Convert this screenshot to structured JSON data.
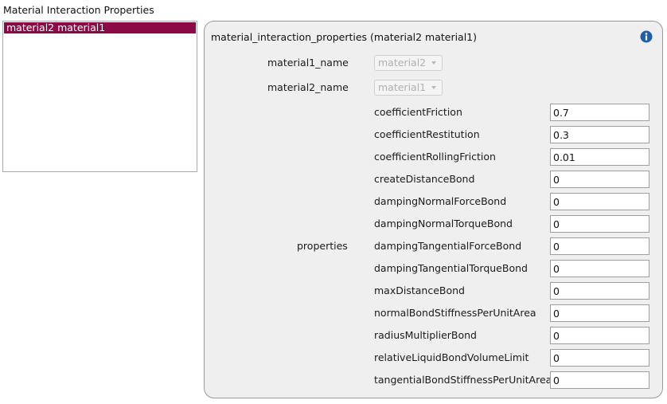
{
  "section_title": "Material Interaction Properties",
  "list": {
    "items": [
      {
        "label": "material2 material1",
        "selected": true
      }
    ]
  },
  "group": {
    "title": "material_interaction_properties (material2 material1)",
    "info_icon": "info-icon",
    "material1_name": {
      "label": "material1_name",
      "value": "material2"
    },
    "material2_name": {
      "label": "material2_name",
      "value": "material1"
    },
    "properties_label": "properties",
    "properties": [
      {
        "name": "coefficientFriction",
        "value": "0.7"
      },
      {
        "name": "coefficientRestitution",
        "value": "0.3"
      },
      {
        "name": "coefficientRollingFriction",
        "value": "0.01"
      },
      {
        "name": "createDistanceBond",
        "value": "0"
      },
      {
        "name": "dampingNormalForceBond",
        "value": "0"
      },
      {
        "name": "dampingNormalTorqueBond",
        "value": "0"
      },
      {
        "name": "dampingTangentialForceBond",
        "value": "0"
      },
      {
        "name": "dampingTangentialTorqueBond",
        "value": "0"
      },
      {
        "name": "maxDistanceBond",
        "value": "0"
      },
      {
        "name": "normalBondStiffnessPerUnitArea",
        "value": "0"
      },
      {
        "name": "radiusMultiplierBond",
        "value": "0"
      },
      {
        "name": "relativeLiquidBondVolumeLimit",
        "value": "0"
      },
      {
        "name": "tangentialBondStiffnessPerUnitArea",
        "value": "0"
      }
    ]
  },
  "colors": {
    "selection": "#8b0a46",
    "info_icon": "#1f5fa8",
    "panel_bg": "#efefef"
  }
}
